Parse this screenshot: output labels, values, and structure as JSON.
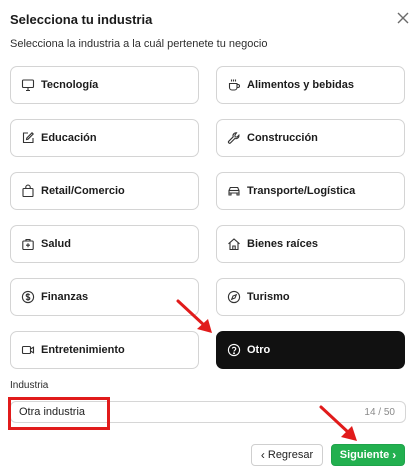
{
  "dialog": {
    "title": "Selecciona tu industria",
    "subtitle": "Selecciona la industria a la cuál pertenete tu negocio"
  },
  "industries": [
    {
      "label": "Tecnología",
      "icon": "monitor-icon"
    },
    {
      "label": "Alimentos y bebidas",
      "icon": "coffee-cup-icon"
    },
    {
      "label": "Educación",
      "icon": "edit-icon"
    },
    {
      "label": "Construcción",
      "icon": "wrench-icon"
    },
    {
      "label": "Retail/Comercio",
      "icon": "shopping-bag-icon"
    },
    {
      "label": "Transporte/Logística",
      "icon": "car-icon"
    },
    {
      "label": "Salud",
      "icon": "medical-kit-icon"
    },
    {
      "label": "Bienes raíces",
      "icon": "house-icon"
    },
    {
      "label": "Finanzas",
      "icon": "dollar-circle-icon"
    },
    {
      "label": "Turismo",
      "icon": "compass-icon"
    },
    {
      "label": "Entretenimiento",
      "icon": "video-icon"
    },
    {
      "label": "Otro",
      "icon": "question-circle-icon",
      "selected": true
    }
  ],
  "industry_field": {
    "label": "Industria",
    "value": "Otra industria",
    "counter": "14 / 50"
  },
  "footer": {
    "back_label": "Regresar",
    "next_label": "Siguiente"
  },
  "colors": {
    "selected_bg": "#111111",
    "primary_green": "#22b04f",
    "annotation_red": "#e11b1b"
  }
}
